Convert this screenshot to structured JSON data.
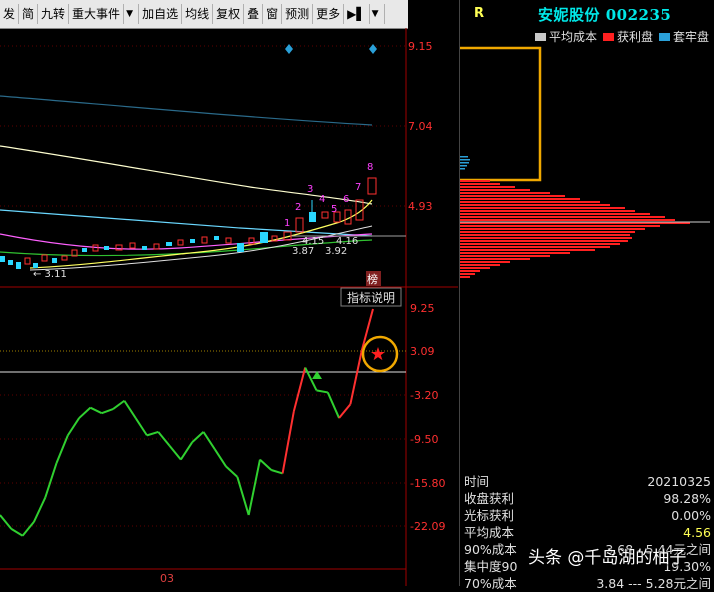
{
  "toolbar": {
    "buttons": [
      "发",
      "简",
      "九转",
      "重大事件",
      "▼",
      "加自选",
      "均线",
      "复权",
      "叠",
      "窗",
      "预测",
      "更多",
      "▶▌",
      "▼"
    ]
  },
  "price_axis": {
    "ticks": [
      "9.15",
      "7.04",
      "4.93"
    ]
  },
  "indicator_axis": {
    "ticks": [
      "9.25",
      "3.09",
      "-3.20",
      "-9.50",
      "-15.80",
      "-22.09"
    ]
  },
  "price_labels": {
    "low_arrow": "← 3.11",
    "ma_label_1": "4.15",
    "ma_label_2": "4.16",
    "ma_label_3": "3.87",
    "ma_label_4": "3.92",
    "count_labels": [
      "1",
      "2",
      "3",
      "4",
      "5",
      "6",
      "7",
      "8"
    ]
  },
  "bang_label": "榜",
  "indicator_button": "指标说明",
  "month_label": "03",
  "stock": {
    "code_letter": "R",
    "name_code": "安妮股份 002235"
  },
  "legend": [
    {
      "label": "平均成本",
      "color": "#c8c8c8"
    },
    {
      "label": "获利盘",
      "color": "#ff2020"
    },
    {
      "label": "套牢盘",
      "color": "#2aa0d8"
    }
  ],
  "stats": [
    {
      "label": "时间",
      "value": "20210325",
      "highlight": false
    },
    {
      "label": "收盘获利",
      "value": "98.28%",
      "highlight": false
    },
    {
      "label": "光标获利",
      "value": "0.00%",
      "highlight": false
    },
    {
      "label": "平均成本",
      "value": "4.56",
      "highlight": true
    },
    {
      "label": "90%成本",
      "value": "3.68 -  5.44元之间",
      "highlight": false
    },
    {
      "label": "集中度90",
      "value": "19.30%",
      "highlight": false
    },
    {
      "label": "70%成本",
      "value": "3.84  ---  5.28元之间",
      "highlight": false
    }
  ],
  "watermark": "头条 @千岛湖的柚子",
  "chart_data": {
    "type": "line",
    "title": "",
    "series": [
      {
        "values": [
          -20.5,
          -22.5,
          -23.5,
          -21.5,
          -18,
          -13,
          -9,
          -6.5,
          -5,
          -5.8,
          -5.2,
          -4,
          -6.5,
          -9,
          -8.5,
          -10.5,
          -12.5,
          -10,
          -8.5,
          -11,
          -13.5,
          -15,
          -20.5,
          -12.5,
          -14,
          -14.5,
          -5.5,
          0.8,
          -2.5,
          -2.8,
          -6.5,
          -4.5,
          3.2,
          9.25
        ]
      }
    ],
    "ylim": [
      -22.09,
      9.25
    ],
    "yticks": [
      9.25,
      3.09,
      -3.2,
      -9.5,
      -15.8,
      -22.09
    ],
    "xlabel": "",
    "ylabel": ""
  }
}
